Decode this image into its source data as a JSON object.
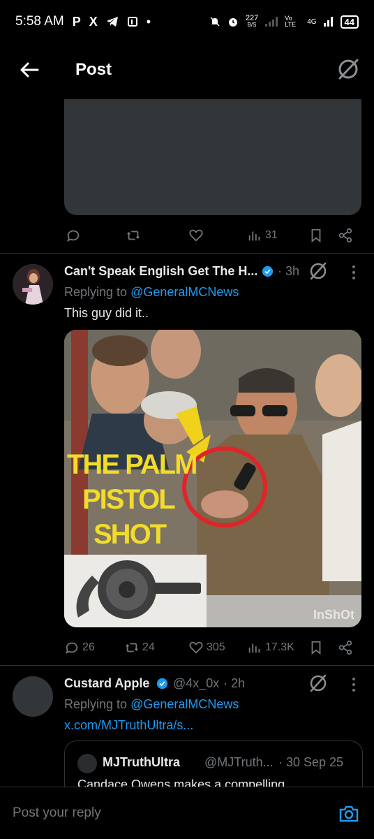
{
  "status_bar": {
    "time": "5:58 AM",
    "apps": [
      "P",
      "X"
    ],
    "data_speed": "227",
    "data_unit": "B/S",
    "network_1": "Vo LTE",
    "network_2": "4G",
    "battery": "44"
  },
  "header": {
    "title": "Post"
  },
  "post_top": {
    "views": "31"
  },
  "tweet1": {
    "author": "Can't Speak English Get The H...",
    "time": "· 3h",
    "replying_prefix": "Replying to",
    "replying_handle": "@GeneralMCNews",
    "text": "This guy did it..",
    "image_caption": {
      "line1": "THE PALM",
      "line2": "PISTOL",
      "line3": "SHOT",
      "watermark": "InShOt"
    },
    "replies": "26",
    "reposts": "24",
    "likes": "305",
    "views": "17.3K"
  },
  "tweet2": {
    "author": "Custard Apple",
    "handle": "@4x_0x",
    "time": "· 2h",
    "replying_prefix": "Replying to",
    "replying_handle": "@GeneralMCNews",
    "link": "x.com/MJTruthUltra/s...",
    "quote": {
      "author": "MJTruthUltra",
      "handle": "@MJTruth...",
      "time": "· 30 Sep 25",
      "text": "Candace Owens makes a compelling"
    }
  },
  "reply_bar": {
    "placeholder": "Post your reply"
  },
  "colors": {
    "accent": "#1d9bf0",
    "muted": "#71767b",
    "background": "#000000"
  }
}
